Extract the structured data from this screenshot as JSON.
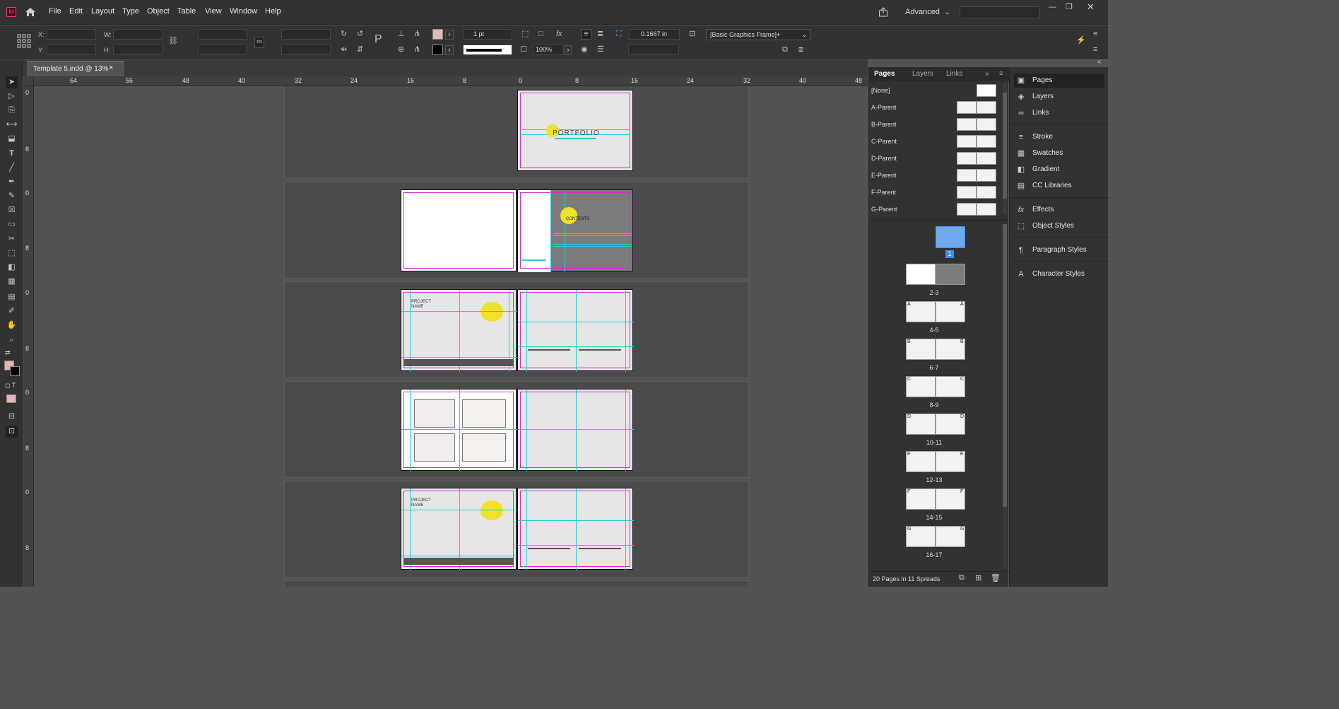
{
  "app": {
    "logo": "Id"
  },
  "menu": [
    "File",
    "Edit",
    "Layout",
    "Type",
    "Object",
    "Table",
    "View",
    "Window",
    "Help"
  ],
  "workspace": {
    "label": "Advanced"
  },
  "control": {
    "x_label": "X:",
    "y_label": "Y:",
    "w_label": "W:",
    "h_label": "H:",
    "stroke_weight": "1 pt",
    "opacity": "100%",
    "offset": "0.1667 in",
    "object_style": "[Basic Graphics Frame]+",
    "fill_color": "#e8b4b4"
  },
  "document": {
    "tab": "Template 5.indd @ 13%",
    "close": "×"
  },
  "rulers": {
    "h": [
      "64",
      "56",
      "48",
      "40",
      "32",
      "24",
      "16",
      "8",
      "0",
      "8",
      "16",
      "24",
      "32",
      "40",
      "48"
    ],
    "v": [
      "0",
      "8",
      "0",
      "8",
      "0",
      "8",
      "0",
      "8",
      "0",
      "8"
    ]
  },
  "spreads_canvas": {
    "cover_title": "PORTFOLIO",
    "contents_label": "CONTENTS",
    "project_label_1": "PROJECT",
    "project_label_2": "NAME"
  },
  "pages_panel": {
    "tabs": [
      "Pages",
      "Layers",
      "Links"
    ],
    "parents": [
      {
        "label": "[None]"
      },
      {
        "label": "A-Parent"
      },
      {
        "label": "B-Parent"
      },
      {
        "label": "C-Parent"
      },
      {
        "label": "D-Parent"
      },
      {
        "label": "E-Parent"
      },
      {
        "label": "F-Parent"
      },
      {
        "label": "G-Parent"
      }
    ],
    "spreads": [
      {
        "label": "1",
        "selected": true
      },
      {
        "label": "2-3"
      },
      {
        "label": "4-5",
        "prefix_left": "A",
        "prefix_right": "A"
      },
      {
        "label": "6-7",
        "prefix_left": "B",
        "prefix_right": "B"
      },
      {
        "label": "8-9",
        "prefix_left": "C",
        "prefix_right": "C"
      },
      {
        "label": "10-11",
        "prefix_left": "D",
        "prefix_right": "D"
      },
      {
        "label": "12-13",
        "prefix_left": "E",
        "prefix_right": "E"
      },
      {
        "label": "14-15",
        "prefix_left": "F",
        "prefix_right": "F"
      },
      {
        "label": "16-17",
        "prefix_left": "G",
        "prefix_right": "G"
      }
    ],
    "footer": "20 Pages in 11 Spreads"
  },
  "dock": [
    {
      "label": "Pages",
      "icon": "pages-icon"
    },
    {
      "label": "Layers",
      "icon": "layers-icon"
    },
    {
      "label": "Links",
      "icon": "links-icon"
    },
    {
      "label": "Stroke",
      "icon": "stroke-icon"
    },
    {
      "label": "Swatches",
      "icon": "swatches-icon"
    },
    {
      "label": "Gradient",
      "icon": "gradient-icon"
    },
    {
      "label": "CC Libraries",
      "icon": "cc-libraries-icon"
    },
    {
      "label": "Effects",
      "icon": "effects-icon"
    },
    {
      "label": "Object Styles",
      "icon": "object-styles-icon"
    },
    {
      "label": "Paragraph Styles",
      "icon": "paragraph-styles-icon"
    },
    {
      "label": "Character Styles",
      "icon": "character-styles-icon"
    }
  ],
  "colors": {
    "accent_yellow": "#f0e22a",
    "guide_cyan": "#21d0d6",
    "margin_magenta": "#d42ad4",
    "selection_blue": "#3e8fe6"
  }
}
